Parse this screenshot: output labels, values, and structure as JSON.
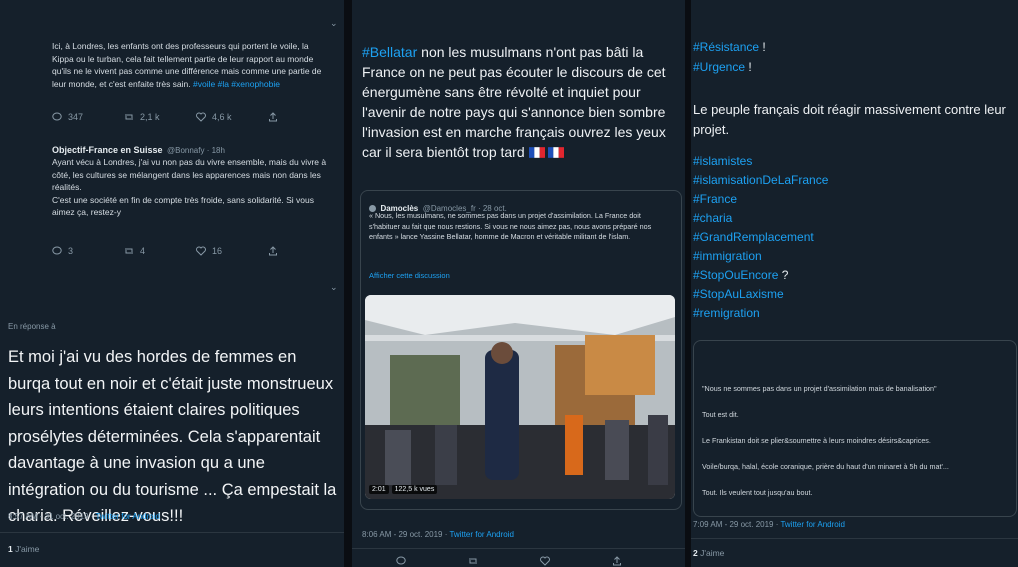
{
  "col1": {
    "tweet1": {
      "text": "Ici, à Londres, les enfants ont des professeurs qui portent le voile, la Kippa ou le turban, cela fait tellement partie de leur rapport au monde qu'ils ne le vivent pas comme une différence mais comme une partie de leur monde, et c'est enfaite très sain.",
      "hashtag": "#voile #la #xenophobie",
      "replies": "347",
      "retweets": "2,1 k",
      "likes": "4,6 k"
    },
    "tweet2": {
      "author": "Objectif-France en Suisse",
      "handle": "@Bonnafy · 18h",
      "text1": "Ayant vécu à Londres, j'ai vu non pas du vivre ensemble, mais du vivre à côté, les cultures se mélangent dans les apparences mais non dans les réalités.",
      "text2": "C'est une société en fin de compte très froide, sans solidarité. Si vous aimez ça, restez-y",
      "replies": "3",
      "retweets": "4",
      "likes": "16"
    },
    "reply_label": "En réponse à",
    "main_text": "Et moi j'ai vu des hordes de femmes en burqa tout en noir et c'était juste monstrueux leurs intentions étaient claires politiques prosélytes déterminées. Cela s'apparentait davantage à une invasion qu a une intégration ou du tourisme ... Ça empestait la charia. Réveillez-vous!!!",
    "timestamp": "8:57 AM - 31 oct. 2019 ·",
    "source": "Twitter for Android",
    "likes_count": "1",
    "likes_label": "J'aime"
  },
  "col2": {
    "hashtag": "#Bellatar",
    "text": " non les musulmans n'ont pas bâti la France on ne peut pas écouter le discours de cet énergumène sans être révolté et inquiet pour l'avenir de notre pays qui s'annonce bien sombre l'invasion est en marche français ouvrez les yeux car il sera bientôt trop tard",
    "quote": {
      "author": "Damoclès",
      "handle": "@Damocles_fr · 28 oct.",
      "text": "« Nous, les musulmans, ne sommes pas dans un projet d'assimilation. La France doit s'habituer au fait que nous restions. Si vous ne nous aimez pas, nous avons préparé nos enfants » lance Yassine Bellatar, homme de Macron et véritable militant de l'islam.",
      "link": "Afficher cette discussion",
      "duration": "2:01",
      "views": "122,5 k vues"
    },
    "timestamp": "8:06 AM - 29 oct. 2019 ·",
    "source": "Twitter for Android"
  },
  "col3": {
    "tag_resistance": "#Résistance",
    "tag_urgence": "#Urgence",
    "excl": " !",
    "text": "Le peuple français doit réagir massivement contre leur projet.",
    "hashtags": [
      "#islamistes",
      "#islamisationDeLaFrance",
      "#France",
      "#charia",
      "#GrandRemplacement",
      "#immigration",
      "#StopOuEncore",
      "#StopAuLaxisme",
      "#remigration"
    ],
    "q_suffix": " ?",
    "card_lines": [
      "\"Nous ne sommes pas dans un projet d'assimilation mais de banalisation\"",
      "Tout est dit.",
      "Le Frankistan doit se plier&soumettre à leurs moindres désirs&caprices.",
      "Voile/burqa, halal, école coranique, prière du haut d'un minaret à 5h du mat'...",
      "Tout. Ils veulent tout jusqu'au bout."
    ],
    "timestamp": "7:09 AM - 29 oct. 2019 ·",
    "source": "Twitter for Android",
    "likes_count": "2",
    "likes_label": "J'aime"
  },
  "colors": {
    "accent": "#1da1f2",
    "bg": "#15202b",
    "divider": "#0a0d12"
  }
}
